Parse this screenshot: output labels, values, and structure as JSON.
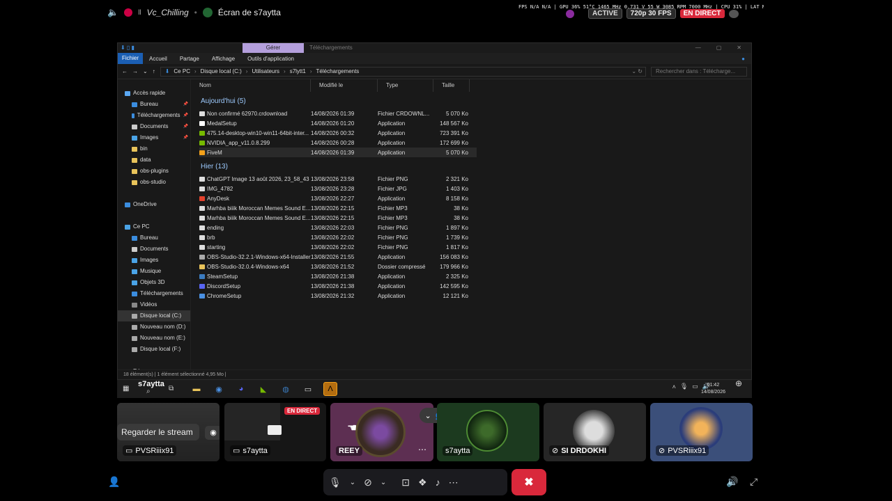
{
  "topbar": {
    "channel": "Vc_Chilling",
    "channel_prefix": "ll",
    "screen_title": "Écran de s7aytta",
    "overlay_stats": "FPS N/A N/A | GPU 36% 51°C 1465 MHz 0.731 V 55 W 3085 RPM 7000 MHz | CPU 31% | LAT N/A N/A",
    "badge_active": "ACTIVE",
    "badge_resolution": "720p 30 FPS",
    "badge_live": "EN DIRECT"
  },
  "explorer": {
    "ctx_tab": "Gérer",
    "ctx_title": "Téléchargements",
    "ribbon": [
      "Fichier",
      "Accueil",
      "Partage",
      "Affichage",
      "Outils d'application"
    ],
    "breadcrumb": [
      "Ce PC",
      "Disque local (C:)",
      "Utilisateurs",
      "s7lytt1",
      "Téléchargements"
    ],
    "search_placeholder": "Rechercher dans : Télécharge...",
    "nav": [
      {
        "label": "Accès rapide",
        "color": "#5aa7f2",
        "indent": 10
      },
      {
        "label": "Bureau",
        "color": "#3b8ddf",
        "indent": 20,
        "pin": true
      },
      {
        "label": "Téléchargements",
        "color": "#3b8ddf",
        "indent": 20,
        "pin": true
      },
      {
        "label": "Documents",
        "color": "#cccccc",
        "indent": 20,
        "pin": true
      },
      {
        "label": "Images",
        "color": "#4aa3e6",
        "indent": 20,
        "pin": true
      },
      {
        "label": "bin",
        "color": "#e8c35a",
        "indent": 20
      },
      {
        "label": "data",
        "color": "#e8c35a",
        "indent": 20
      },
      {
        "label": "obs-plugins",
        "color": "#e8c35a",
        "indent": 20
      },
      {
        "label": "obs-studio",
        "color": "#e8c35a",
        "indent": 20
      },
      {
        "label": "",
        "color": "",
        "indent": 0
      },
      {
        "label": "OneDrive",
        "color": "#3b8ddf",
        "indent": 10
      },
      {
        "label": "",
        "color": "",
        "indent": 0
      },
      {
        "label": "Ce PC",
        "color": "#4aa3e6",
        "indent": 10
      },
      {
        "label": "Bureau",
        "color": "#3b8ddf",
        "indent": 20
      },
      {
        "label": "Documents",
        "color": "#cccccc",
        "indent": 20
      },
      {
        "label": "Images",
        "color": "#4aa3e6",
        "indent": 20
      },
      {
        "label": "Musique",
        "color": "#4aa3e6",
        "indent": 20
      },
      {
        "label": "Objets 3D",
        "color": "#4aa3e6",
        "indent": 20
      },
      {
        "label": "Téléchargements",
        "color": "#3b8ddf",
        "indent": 20
      },
      {
        "label": "Vidéos",
        "color": "#888888",
        "indent": 20
      },
      {
        "label": "Disque local (C:)",
        "color": "#aaaaaa",
        "indent": 20,
        "selected": true
      },
      {
        "label": "Nouveau nom (D:)",
        "color": "#aaaaaa",
        "indent": 20
      },
      {
        "label": "Nouveau nom (E:)",
        "color": "#aaaaaa",
        "indent": 20
      },
      {
        "label": "Disque local (F:)",
        "color": "#aaaaaa",
        "indent": 20
      },
      {
        "label": "",
        "color": "",
        "indent": 0
      },
      {
        "label": "Réseau",
        "color": "#4aa3e6",
        "indent": 10
      }
    ],
    "columns": [
      "Nom",
      "Modifié le",
      "Type",
      "Taille"
    ],
    "groups": [
      {
        "title": "Aujourd'hui (5)",
        "files": [
          {
            "name": "Non confirmé 62970.crdownload",
            "date": "14/08/2026 01:39",
            "type": "Fichier CRDOWNL...",
            "size": "5 070 Ko",
            "color": "#dddddd"
          },
          {
            "name": "MedalSetup",
            "date": "14/08/2026 01:20",
            "type": "Application",
            "size": "148 567 Ko",
            "color": "#ffffff"
          },
          {
            "name": "475.14-desktop-win10-win11-64bit-inter...",
            "date": "14/08/2026 00:32",
            "type": "Application",
            "size": "723 391 Ko",
            "color": "#76b900"
          },
          {
            "name": "NVIDIA_app_v11.0.8.299",
            "date": "14/08/2026 00:28",
            "type": "Application",
            "size": "172 699 Ko",
            "color": "#76b900"
          },
          {
            "name": "FiveM",
            "date": "14/08/2026 01:39",
            "type": "Application",
            "size": "5 070 Ko",
            "color": "#f4a11a",
            "selected": true
          }
        ]
      },
      {
        "title": "Hier (13)",
        "files": [
          {
            "name": "ChatGPT Image 13 août 2026, 23_58_43",
            "date": "13/08/2026 23:58",
            "type": "Fichier PNG",
            "size": "2 321 Ko",
            "color": "#dddddd"
          },
          {
            "name": "IMG_4782",
            "date": "13/08/2026 23:28",
            "type": "Fichier JPG",
            "size": "1 403 Ko",
            "color": "#dddddd"
          },
          {
            "name": "AnyDesk",
            "date": "13/08/2026 22:27",
            "type": "Application",
            "size": "8 158 Ko",
            "color": "#e2412c"
          },
          {
            "name": "Marhba biiik  Moroccan Memes Sound E...",
            "date": "13/08/2026 22:15",
            "type": "Fichier MP3",
            "size": "38 Ko",
            "color": "#dddddd"
          },
          {
            "name": "Marhba biiik  Moroccan Memes Sound E...",
            "date": "13/08/2026 22:15",
            "type": "Fichier MP3",
            "size": "38 Ko",
            "color": "#dddddd"
          },
          {
            "name": "ending",
            "date": "13/08/2026 22:03",
            "type": "Fichier PNG",
            "size": "1 897 Ko",
            "color": "#dddddd"
          },
          {
            "name": "brb",
            "date": "13/08/2026 22:02",
            "type": "Fichier PNG",
            "size": "1 739 Ko",
            "color": "#dddddd"
          },
          {
            "name": "starting",
            "date": "13/08/2026 22:02",
            "type": "Fichier PNG",
            "size": "1 817 Ko",
            "color": "#dddddd"
          },
          {
            "name": "OBS-Studio-32.2.1-Windows-x64-Installer",
            "date": "13/08/2026 21:55",
            "type": "Application",
            "size": "156 083 Ko",
            "color": "#aaaaaa"
          },
          {
            "name": "OBS-Studio-32.0.4-Windows-x64",
            "date": "13/08/2026 21:52",
            "type": "Dossier compressé",
            "size": "179 966 Ko",
            "color": "#e8c35a"
          },
          {
            "name": "SteamSetup",
            "date": "13/08/2026 21:38",
            "type": "Application",
            "size": "2 325 Ko",
            "color": "#3b7bbf"
          },
          {
            "name": "DiscordSetup",
            "date": "13/08/2026 21:38",
            "type": "Application",
            "size": "142 595 Ko",
            "color": "#5865f2"
          },
          {
            "name": "ChromeSetup",
            "date": "13/08/2026 21:32",
            "type": "Application",
            "size": "12 121 Ko",
            "color": "#4a90e2"
          }
        ]
      }
    ],
    "status": "18 élément(s)   |   1 élément sélectionné  4,95 Mo   |"
  },
  "taskbar": {
    "streamer": "s7aytta",
    "time": "01:42",
    "date": "14/08/2026",
    "apps": [
      {
        "name": "file-explorer-icon",
        "color": "#e8c35a",
        "glyph": "▬"
      },
      {
        "name": "chrome-icon",
        "color": "#4a90e2",
        "glyph": "◉"
      },
      {
        "name": "discord-icon",
        "color": "#5865f2",
        "glyph": "◕"
      },
      {
        "name": "nvidia-icon",
        "color": "#76b900",
        "glyph": "◣"
      },
      {
        "name": "steam-icon",
        "color": "#3b7bbf",
        "glyph": "◍"
      },
      {
        "name": "medal-icon",
        "color": "#dddddd",
        "glyph": "▭"
      },
      {
        "name": "fivem-icon",
        "color": "#f4a11a",
        "glyph": "Λ"
      }
    ]
  },
  "participants": {
    "watch_button": "Regarder le stream",
    "tile1_name": "PVSRiiix91",
    "tile2_name": "s7aytta",
    "tile2_live": "EN DIRECT",
    "tile3_name": "REEY",
    "tile4_name": "s7aytta",
    "tile5_name": "SI DRDOKHI",
    "tile6_name": "PVSRiiix91"
  },
  "colors": {
    "live": "#d9283b",
    "accent": "#5865f2",
    "hangup": "#d9283b"
  }
}
